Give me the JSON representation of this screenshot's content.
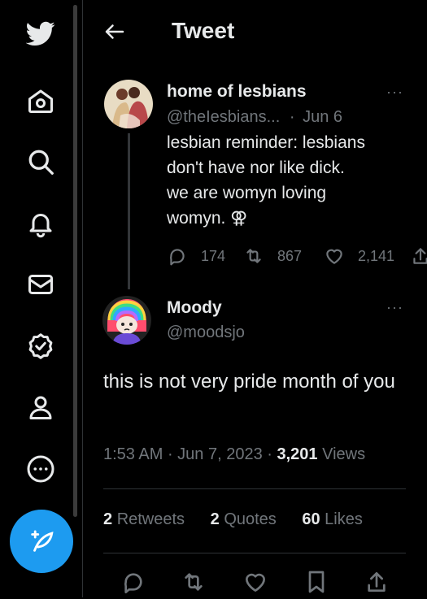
{
  "header": {
    "title": "Tweet"
  },
  "parent_tweet": {
    "name": "home of lesbians",
    "handle": "@theIesbians...",
    "separator": "·",
    "date": "Jun 6",
    "more": "···",
    "text_lines": [
      "lesbian reminder: lesbians",
      "don't have nor like dick.",
      "we are womyn loving",
      "womyn. ⚢"
    ],
    "replies": "174",
    "retweets": "867",
    "likes": "2,141"
  },
  "reply_tweet": {
    "name": "Moody",
    "handle": "@moodsjo",
    "more": "···",
    "text": "this is not very pride month of you",
    "time": "1:53 AM",
    "date": "Jun 7, 2023",
    "views_count": "3,201",
    "views_label": "Views",
    "retweets_count": "2",
    "retweets_label": "Retweets",
    "quotes_count": "2",
    "quotes_label": "Quotes",
    "likes_count": "60",
    "likes_label": "Likes"
  },
  "colors": {
    "accent": "#1d9bf0",
    "muted": "#71767b",
    "text": "#e7e9ea",
    "background": "#000000"
  }
}
